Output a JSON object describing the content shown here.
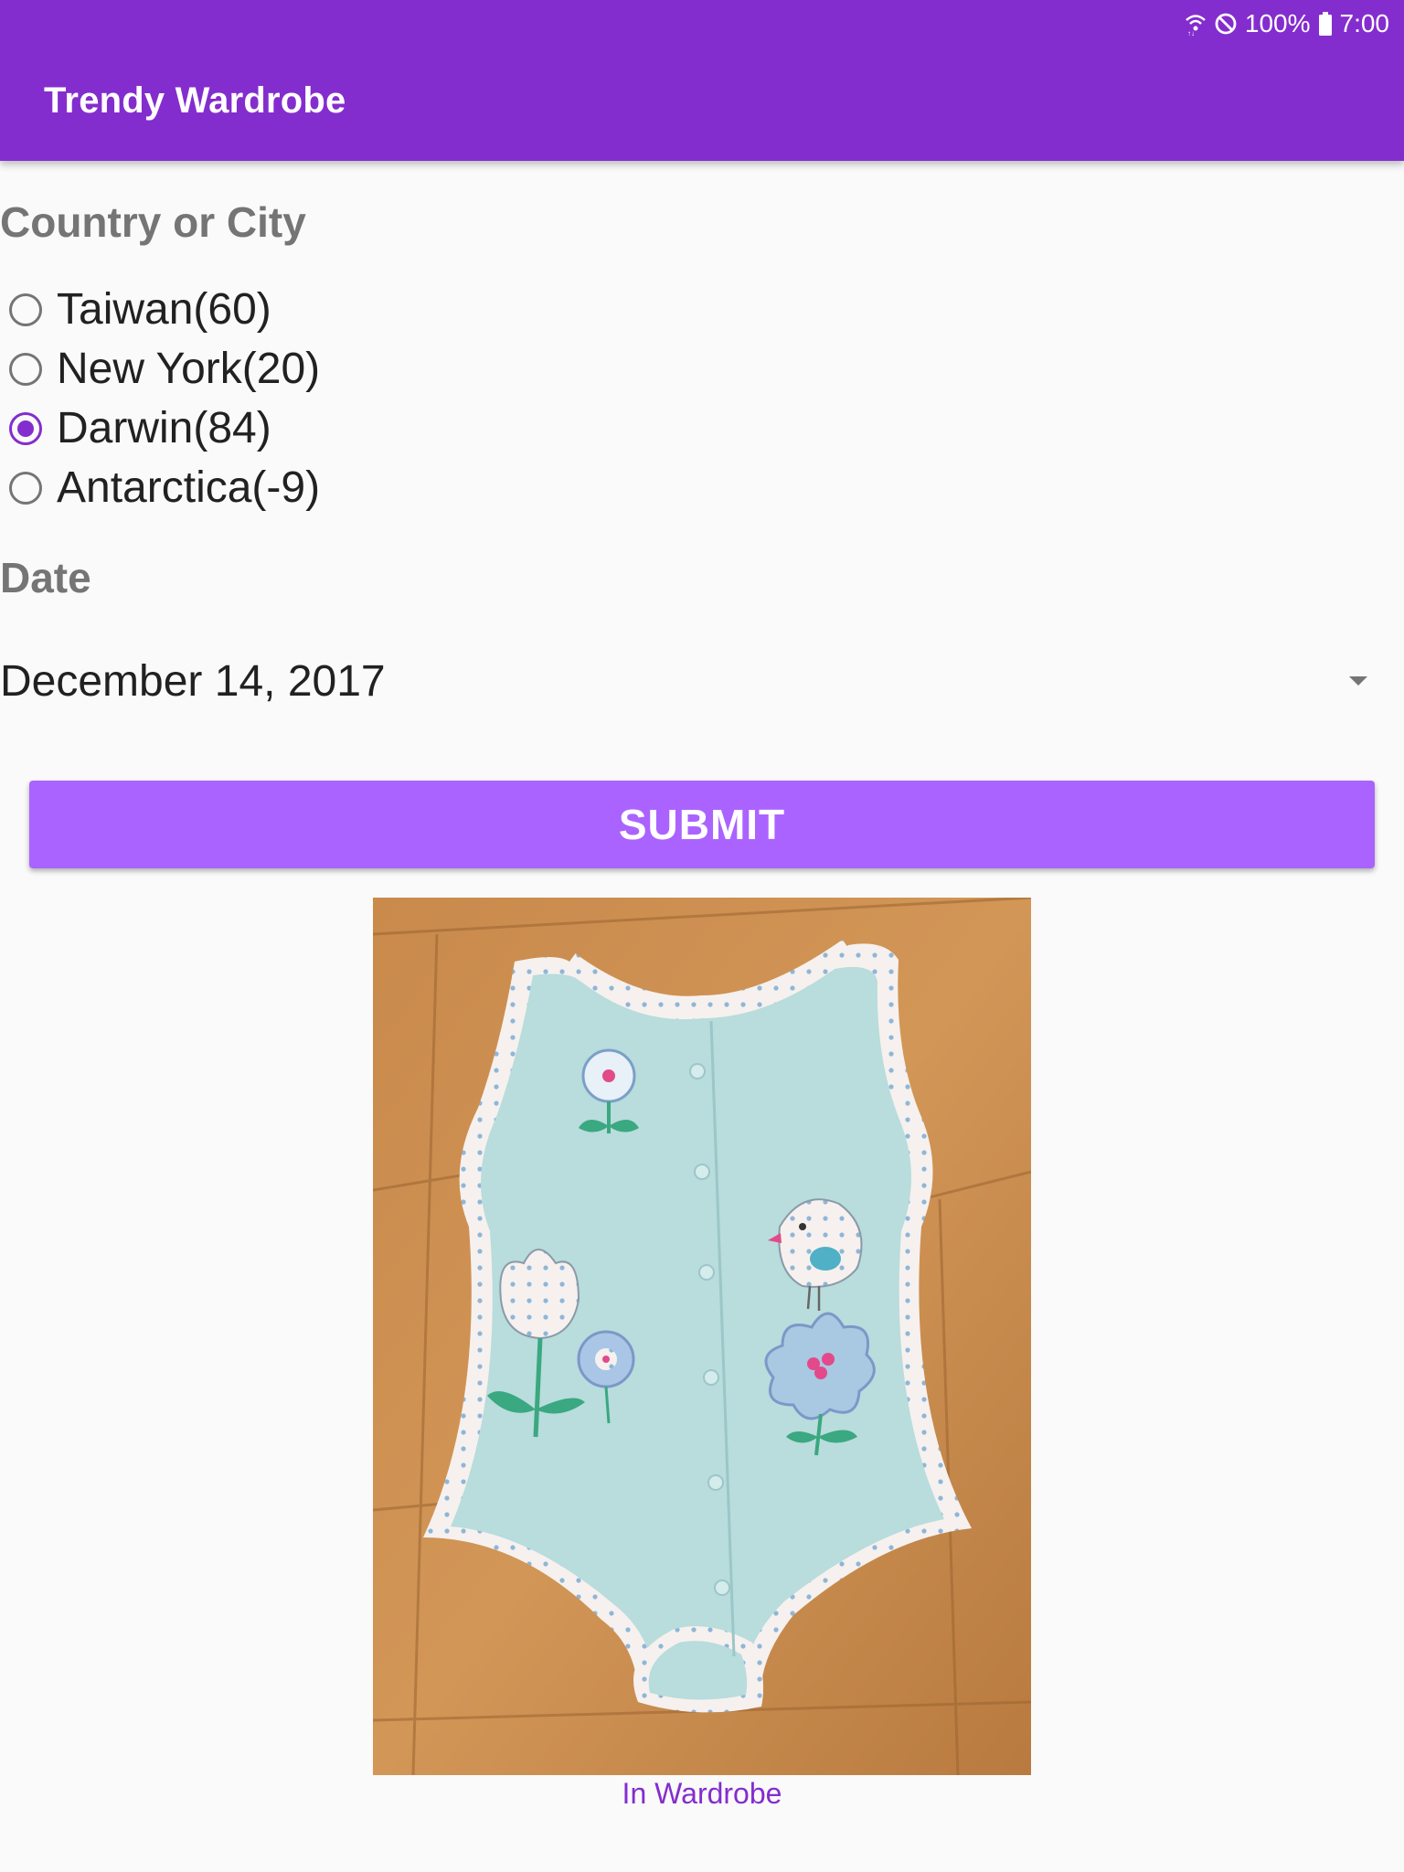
{
  "status_bar": {
    "battery": "100%",
    "time": "7:00"
  },
  "app_bar": {
    "title": "Trendy Wardrobe"
  },
  "form": {
    "location_label": "Country or City",
    "locations": [
      {
        "label": "Taiwan(60)",
        "selected": false
      },
      {
        "label": "New York(20)",
        "selected": false
      },
      {
        "label": "Darwin(84)",
        "selected": true
      },
      {
        "label": "Antarctica(-9)",
        "selected": false
      }
    ],
    "date_label": "Date",
    "date_value": "December 14, 2017",
    "submit_label": "SUBMIT"
  },
  "result": {
    "image": "baby-onesie-photo",
    "caption": "In Wardrobe"
  },
  "colors": {
    "primary": "#842dce",
    "button": "#ab63ff",
    "label_gray": "#757575",
    "background": "#fafafa"
  }
}
